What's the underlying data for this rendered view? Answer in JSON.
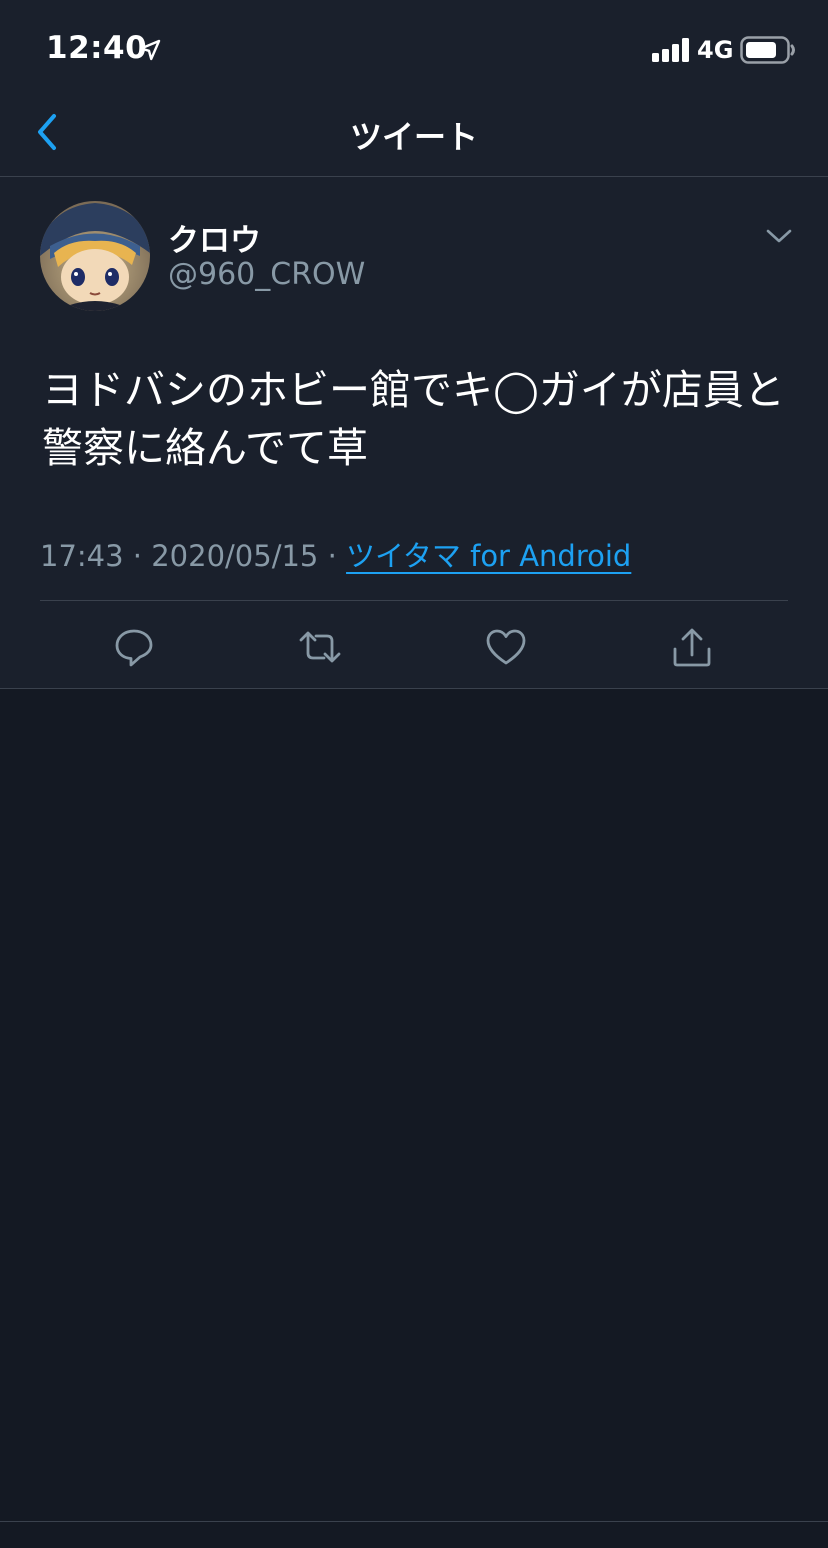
{
  "status_bar": {
    "time": "12:40",
    "network": "4G",
    "icons": [
      "location-arrow-icon",
      "signal-bars-icon",
      "battery-icon"
    ]
  },
  "header": {
    "title": "ツイート",
    "back_icon": "chevron-left-icon"
  },
  "tweet": {
    "display_name": "クロウ",
    "username": "@960_CROW",
    "text": "ヨドバシのホビー館でキ◯ガイが店員と警察に絡んでて草",
    "time": "17:43",
    "separator": " · ",
    "date": "2020/05/15",
    "source": "ツイタマ for Android",
    "menu_icon": "chevron-down-icon",
    "actions": [
      "reply-icon",
      "retweet-icon",
      "like-icon",
      "share-icon"
    ]
  },
  "colors": {
    "background": "#141923",
    "surface": "#1a202c",
    "divider": "#3a414d",
    "secondary_text": "#8899a6",
    "accent": "#1da1f2"
  }
}
